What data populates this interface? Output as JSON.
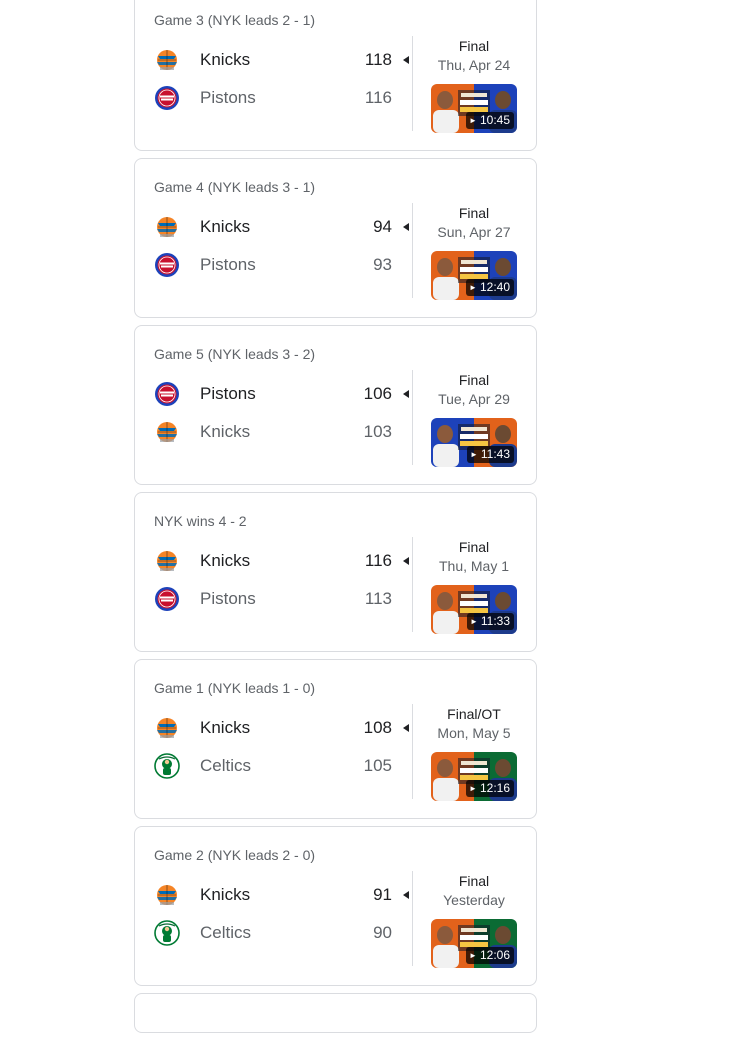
{
  "colors": {
    "knicks_orange": "#f58426",
    "knicks_blue": "#006bb6",
    "pistons_red": "#c8102e",
    "pistons_blue": "#1d42ba",
    "celtics_green": "#007a33",
    "border": "#dadce0",
    "secondary_text": "#5f6368"
  },
  "games": [
    {
      "header": "Game 3 (NYK leads 2 - 1)",
      "teams": [
        {
          "name": "Knicks",
          "score": "118",
          "logo": "knicks-logo-icon",
          "winner": true
        },
        {
          "name": "Pistons",
          "score": "116",
          "logo": "pistons-logo-icon",
          "winner": false
        }
      ],
      "status": "Final",
      "date": "Thu, Apr 24",
      "video": {
        "duration": "10:45",
        "left_color": "#e2621b",
        "right_color": "#1d42ba"
      }
    },
    {
      "header": "Game 4 (NYK leads 3 - 1)",
      "teams": [
        {
          "name": "Knicks",
          "score": "94",
          "logo": "knicks-logo-icon",
          "winner": true
        },
        {
          "name": "Pistons",
          "score": "93",
          "logo": "pistons-logo-icon",
          "winner": false
        }
      ],
      "status": "Final",
      "date": "Sun, Apr 27",
      "video": {
        "duration": "12:40",
        "left_color": "#e2621b",
        "right_color": "#1d42ba"
      }
    },
    {
      "header": "Game 5 (NYK leads 3 - 2)",
      "teams": [
        {
          "name": "Pistons",
          "score": "106",
          "logo": "pistons-logo-icon",
          "winner": true
        },
        {
          "name": "Knicks",
          "score": "103",
          "logo": "knicks-logo-icon",
          "winner": false
        }
      ],
      "status": "Final",
      "date": "Tue, Apr 29",
      "video": {
        "duration": "11:43",
        "left_color": "#1d42ba",
        "right_color": "#e2621b"
      }
    },
    {
      "header": "NYK wins 4 - 2",
      "teams": [
        {
          "name": "Knicks",
          "score": "116",
          "logo": "knicks-logo-icon",
          "winner": true
        },
        {
          "name": "Pistons",
          "score": "113",
          "logo": "pistons-logo-icon",
          "winner": false
        }
      ],
      "status": "Final",
      "date": "Thu, May 1",
      "video": {
        "duration": "11:33",
        "left_color": "#e2621b",
        "right_color": "#1d42ba"
      }
    },
    {
      "header": "Game 1 (NYK leads 1 - 0)",
      "teams": [
        {
          "name": "Knicks",
          "score": "108",
          "logo": "knicks-logo-icon",
          "winner": true
        },
        {
          "name": "Celtics",
          "score": "105",
          "logo": "celtics-logo-icon",
          "winner": false
        }
      ],
      "status": "Final/OT",
      "date": "Mon, May 5",
      "video": {
        "duration": "12:16",
        "left_color": "#e2621b",
        "right_color": "#0b6b34"
      }
    },
    {
      "header": "Game 2 (NYK leads 2 - 0)",
      "teams": [
        {
          "name": "Knicks",
          "score": "91",
          "logo": "knicks-logo-icon",
          "winner": true
        },
        {
          "name": "Celtics",
          "score": "90",
          "logo": "celtics-logo-icon",
          "winner": false
        }
      ],
      "status": "Final",
      "date": "Yesterday",
      "video": {
        "duration": "12:06",
        "left_color": "#e2621b",
        "right_color": "#0b6b34"
      }
    }
  ]
}
